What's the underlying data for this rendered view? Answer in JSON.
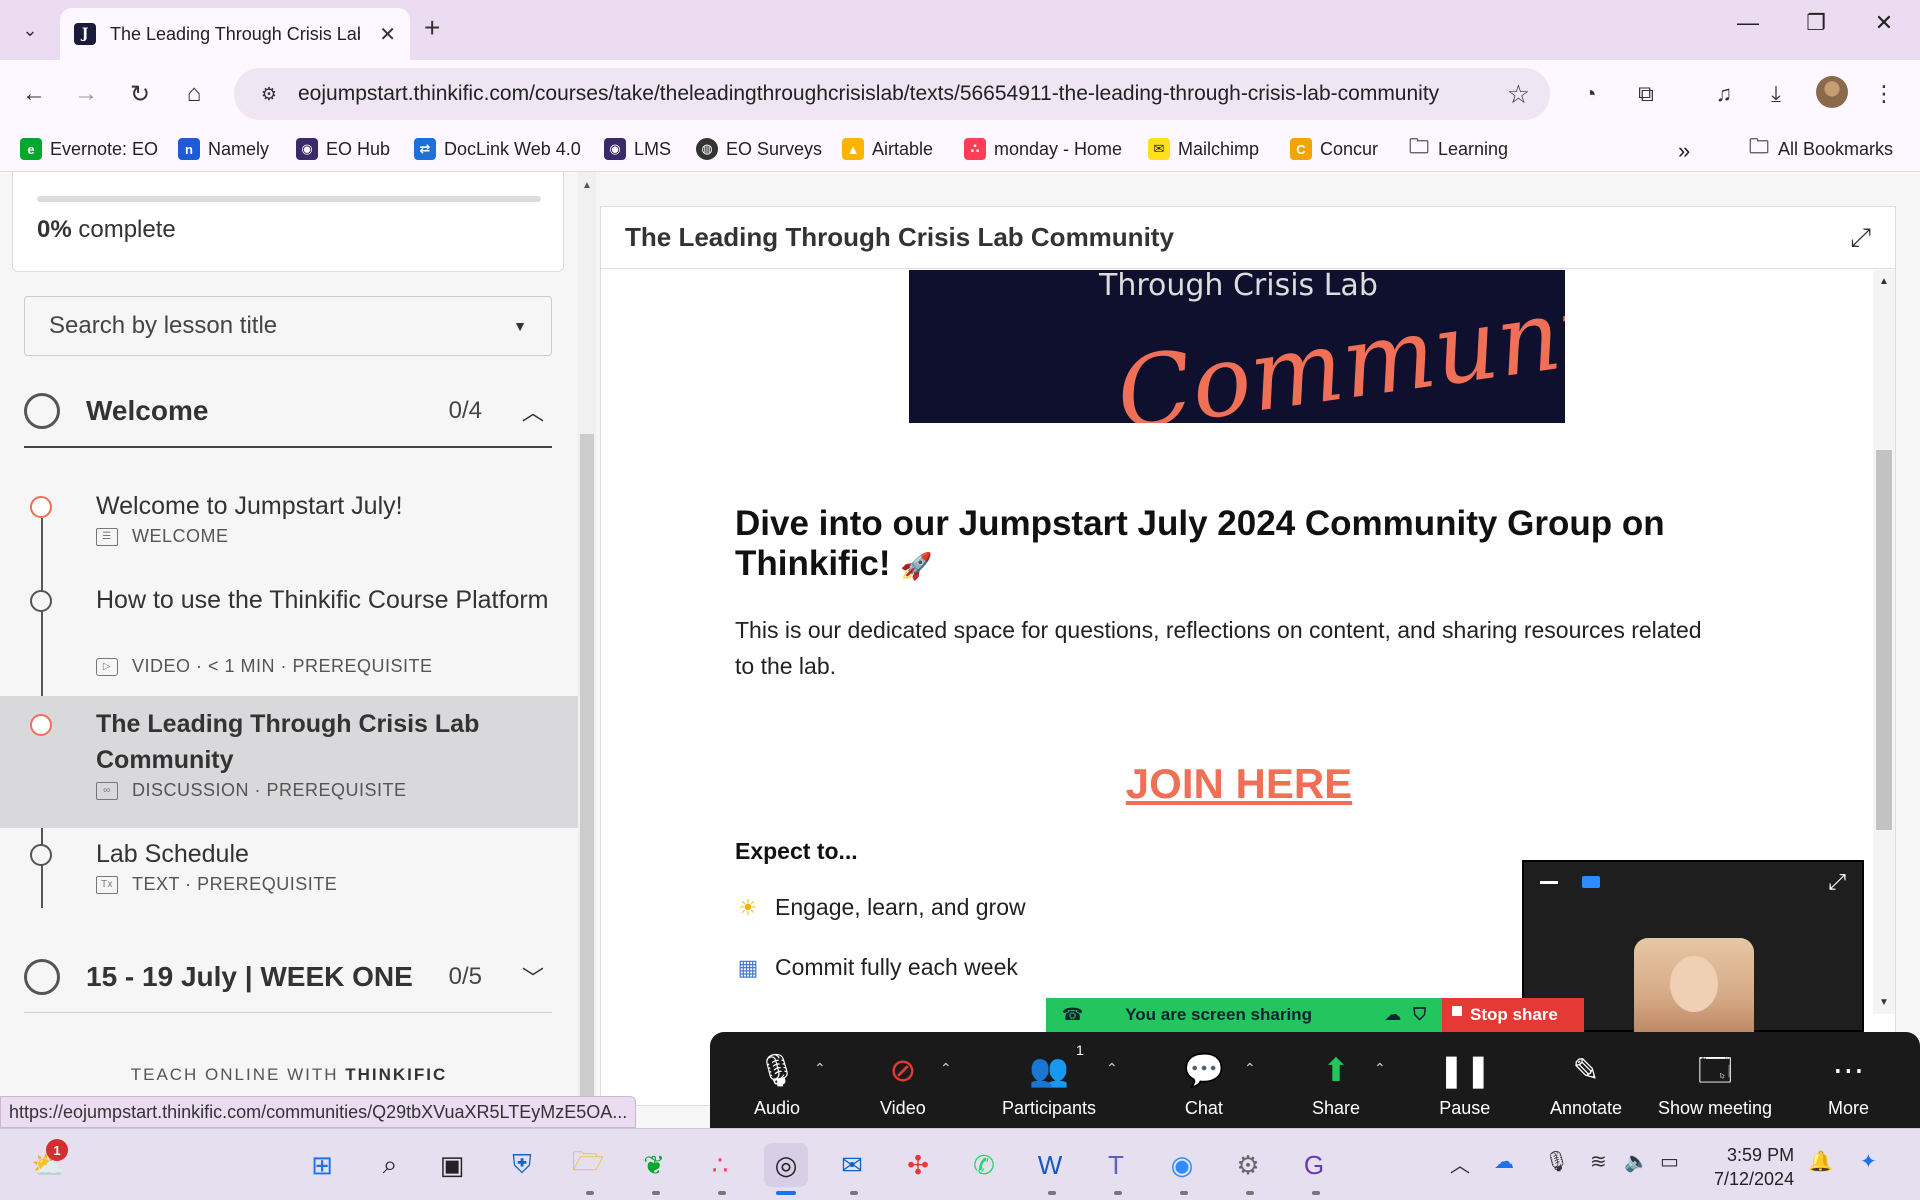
{
  "browser": {
    "tab_title": "The Leading Through Crisis Lab",
    "url": "eojumpstart.thinkific.com/courses/take/theleadingthroughcrisislab/texts/56654911-the-leading-through-crisis-lab-community",
    "status_url": "https://eojumpstart.thinkific.com/communities/Q29tbXVuaXR5LTEyMzE5OA...",
    "bookmarks": [
      {
        "label": "Evernote: EO",
        "color": "#00a82d"
      },
      {
        "label": "Namely",
        "color": "#1e5bd6"
      },
      {
        "label": "EO Hub",
        "color": "#3a2a6a"
      },
      {
        "label": "DocLink Web 4.0",
        "color": "#1e6fd6"
      },
      {
        "label": "LMS",
        "color": "#3a2a6a"
      },
      {
        "label": "EO Surveys",
        "color": "#333333"
      },
      {
        "label": "Airtable",
        "color": "#fcb400"
      },
      {
        "label": "monday - Home",
        "color": "#ff3d57"
      },
      {
        "label": "Mailchimp",
        "color": "#ffe01b"
      },
      {
        "label": "Concur",
        "color": "#f0a500"
      },
      {
        "label": "Learning",
        "color": "#555555"
      }
    ],
    "all_bookmarks": "All Bookmarks"
  },
  "sidebar": {
    "progress_percent": "0%",
    "progress_suffix": " complete",
    "progress_value": 0,
    "search_placeholder": "Search by lesson title",
    "chapters": [
      {
        "title": "Welcome",
        "count": "0/4",
        "expanded": true
      },
      {
        "title": "15 - 19 July | WEEK ONE",
        "count": "0/5",
        "expanded": false
      }
    ],
    "lessons": [
      {
        "title": "Welcome to Jumpstart July!",
        "meta": "WELCOME",
        "status": "in-progress"
      },
      {
        "title": "How to use the Thinkific Course Platform",
        "meta": "VIDEO · < 1 MIN · PREREQUISITE",
        "status": "not-started"
      },
      {
        "title": "The Leading Through Crisis Lab Community",
        "meta": "DISCUSSION · PREREQUISITE",
        "status": "active"
      },
      {
        "title": "Lab Schedule",
        "meta": "TEXT · PREREQUISITE",
        "status": "not-started"
      }
    ],
    "footer_prefix": "TEACH ONLINE WITH ",
    "footer_brand": "THINKIFIC"
  },
  "content": {
    "header_title": "The Leading Through Crisis Lab Community",
    "banner_subtitle": "Through Crisis Lab",
    "banner_script": "Community",
    "post_title": "Dive into our Jumpstart July 2024 Community Group on Thinkific!",
    "post_emoji": "🚀",
    "post_text": "This is our dedicated space for questions, reflections on content, and sharing resources related to the lab.",
    "join_link": "JOIN HERE",
    "expect_heading": "Expect to...",
    "bullets": [
      {
        "icon": "☀",
        "text": "Engage, learn, and grow"
      },
      {
        "icon": "▦",
        "text": "Commit fully each week"
      }
    ]
  },
  "zoom": {
    "sharing_text": "You are screen sharing",
    "stop_share": "Stop share",
    "participants_count": "1",
    "controls": [
      {
        "label": "Audio"
      },
      {
        "label": "Video"
      },
      {
        "label": "Participants"
      },
      {
        "label": "Chat"
      },
      {
        "label": "Share"
      },
      {
        "label": "Pause"
      },
      {
        "label": "Annotate"
      },
      {
        "label": "Show meeting"
      },
      {
        "label": "More"
      }
    ]
  },
  "taskbar": {
    "time": "3:59 PM",
    "date": "7/12/2024",
    "weather_badge": "1"
  }
}
